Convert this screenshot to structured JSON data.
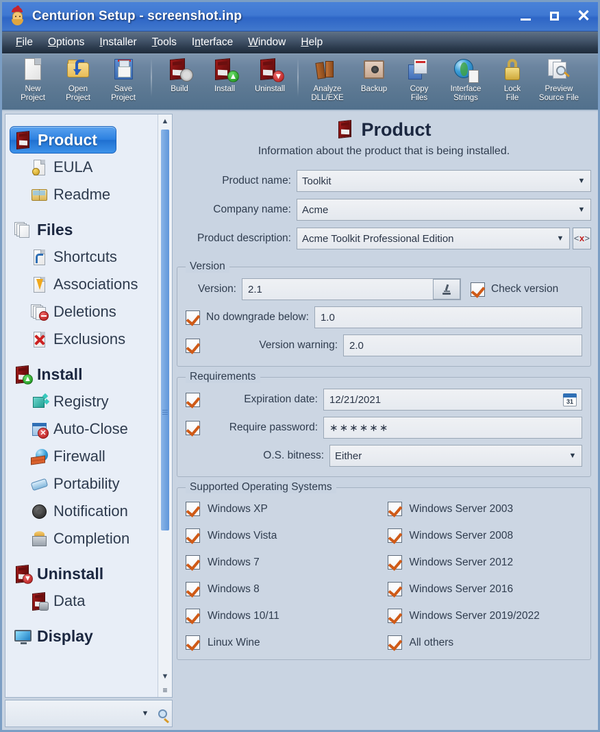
{
  "window": {
    "title": "Centurion Setup - screenshot.inp",
    "app_icon": "centurion-helmet-icon",
    "minimize_label": "Minimize",
    "maximize_label": "Maximize",
    "close_label": "Close"
  },
  "menubar": [
    {
      "label": "File",
      "accel": "F"
    },
    {
      "label": "Options",
      "accel": "O"
    },
    {
      "label": "Installer",
      "accel": "I"
    },
    {
      "label": "Tools",
      "accel": "T"
    },
    {
      "label": "Interface",
      "accel": "I"
    },
    {
      "label": "Window",
      "accel": "W"
    },
    {
      "label": "Help",
      "accel": "H"
    }
  ],
  "toolbar": [
    {
      "id": "new-project",
      "line1": "New",
      "line2": "Project",
      "icon": "new-page-icon"
    },
    {
      "id": "open-project",
      "line1": "Open",
      "line2": "Project",
      "icon": "open-folder-icon"
    },
    {
      "id": "save-project",
      "line1": "Save",
      "line2": "Project",
      "icon": "floppy-disk-icon"
    },
    {
      "id": "build",
      "line1": "Build",
      "line2": "",
      "icon": "build-gear-box-icon"
    },
    {
      "id": "install",
      "line1": "Install",
      "line2": "",
      "icon": "install-up-arrow-box-icon"
    },
    {
      "id": "uninstall",
      "line1": "Uninstall",
      "line2": "",
      "icon": "uninstall-down-arrow-box-icon"
    },
    {
      "id": "analyze-dll-exe",
      "line1": "Analyze",
      "line2": "DLL/EXE",
      "icon": "books-icon"
    },
    {
      "id": "backup",
      "line1": "Backup",
      "line2": "",
      "icon": "safe-icon"
    },
    {
      "id": "copy-files",
      "line1": "Copy",
      "line2": "Files",
      "icon": "copy-files-icon"
    },
    {
      "id": "interface-strings",
      "line1": "Interface",
      "line2": "Strings",
      "icon": "globe-document-icon"
    },
    {
      "id": "lock-file",
      "line1": "Lock",
      "line2": "File",
      "icon": "padlock-icon"
    },
    {
      "id": "preview-source-file",
      "line1": "Preview",
      "line2": "Source File",
      "icon": "preview-magnifier-icon"
    }
  ],
  "sidebar": {
    "items": [
      {
        "label": "Product",
        "level": "group",
        "selected": true,
        "icon": "product-box-icon"
      },
      {
        "label": "EULA",
        "level": "child",
        "selected": false,
        "icon": "eula-document-icon"
      },
      {
        "label": "Readme",
        "level": "child",
        "selected": false,
        "icon": "readme-book-icon"
      },
      {
        "label": "Files",
        "level": "group",
        "selected": false,
        "icon": "files-stack-icon"
      },
      {
        "label": "Shortcuts",
        "level": "child",
        "selected": false,
        "icon": "shortcut-arrow-icon"
      },
      {
        "label": "Associations",
        "level": "child",
        "selected": false,
        "icon": "association-bolt-icon"
      },
      {
        "label": "Deletions",
        "level": "child",
        "selected": false,
        "icon": "deletions-minus-icon"
      },
      {
        "label": "Exclusions",
        "level": "child",
        "selected": false,
        "icon": "exclusions-x-icon"
      },
      {
        "label": "Install",
        "level": "group",
        "selected": false,
        "icon": "install-box-icon"
      },
      {
        "label": "Registry",
        "level": "child",
        "selected": false,
        "icon": "registry-cube-icon"
      },
      {
        "label": "Auto-Close",
        "level": "child",
        "selected": false,
        "icon": "auto-close-window-icon"
      },
      {
        "label": "Firewall",
        "level": "child",
        "selected": false,
        "icon": "firewall-icon"
      },
      {
        "label": "Portability",
        "level": "child",
        "selected": false,
        "icon": "usb-drive-icon"
      },
      {
        "label": "Notification",
        "level": "child",
        "selected": false,
        "icon": "speaker-icon"
      },
      {
        "label": "Completion",
        "level": "child",
        "selected": false,
        "icon": "completion-box-icon"
      },
      {
        "label": "Uninstall",
        "level": "group",
        "selected": false,
        "icon": "uninstall-box-icon"
      },
      {
        "label": "Data",
        "level": "child",
        "selected": false,
        "icon": "data-box-icon"
      },
      {
        "label": "Display",
        "level": "group",
        "selected": false,
        "icon": "display-monitor-icon"
      }
    ],
    "scroll_up": "▲",
    "scroll_down": "▼",
    "resize_grip": "≡",
    "search": {
      "value": "",
      "placeholder": "",
      "dropdown_arrow": "▼",
      "magnifier": "search-icon"
    }
  },
  "main": {
    "page_icon": "product-box-icon",
    "page_title": "Product",
    "page_subtitle": "Information about the product that is being installed.",
    "fields": [
      {
        "label": "Product name:",
        "value": "Toolkit",
        "type": "combobox"
      },
      {
        "label": "Company name:",
        "value": "Acme",
        "type": "combobox"
      },
      {
        "label": "Product description:",
        "value": "Acme Toolkit Professional Edition",
        "type": "combobox",
        "extra_button": "<x>"
      }
    ],
    "version_group": {
      "title": "Version",
      "version_label": "Version:",
      "version_value": "2.1",
      "microscope_button": "microscope-icon",
      "check_version_label": "Check version",
      "check_version_checked": true,
      "no_downgrade_label": "No downgrade below:",
      "no_downgrade_checked": true,
      "no_downgrade_value": "1.0",
      "version_warning_label": "Version warning:",
      "version_warning_checked": true,
      "version_warning_value": "2.0"
    },
    "requirements_group": {
      "title": "Requirements",
      "expiration_label": "Expiration date:",
      "expiration_checked": true,
      "expiration_value": "12/21/2021",
      "calendar_icon": "calendar-icon",
      "calendar_day": "31",
      "password_label": "Require password:",
      "password_checked": true,
      "password_value": "∗∗∗∗∗∗",
      "bitness_label": "O.S. bitness:",
      "bitness_value": "Either"
    },
    "os_group": {
      "title": "Supported Operating Systems",
      "items": [
        {
          "label": "Windows XP",
          "checked": true
        },
        {
          "label": "Windows Server 2003",
          "checked": true
        },
        {
          "label": "Windows Vista",
          "checked": true
        },
        {
          "label": "Windows Server 2008",
          "checked": true
        },
        {
          "label": "Windows 7",
          "checked": true
        },
        {
          "label": "Windows Server 2012",
          "checked": true
        },
        {
          "label": "Windows 8",
          "checked": true
        },
        {
          "label": "Windows Server 2016",
          "checked": true
        },
        {
          "label": "Windows 10/11",
          "checked": true
        },
        {
          "label": "Windows Server 2019/2022",
          "checked": true
        },
        {
          "label": "Linux Wine",
          "checked": true
        },
        {
          "label": "All others",
          "checked": true
        }
      ]
    }
  },
  "colors": {
    "title_bar": "#3f78d2",
    "menu_bar": "#2b3a4c",
    "toolbar": "#5d7993",
    "panel_bg": "#c9d4e2",
    "sidebar_bg": "#e8eef7",
    "selection": "#2a7fe0",
    "checkmark": "#cf5a17"
  }
}
